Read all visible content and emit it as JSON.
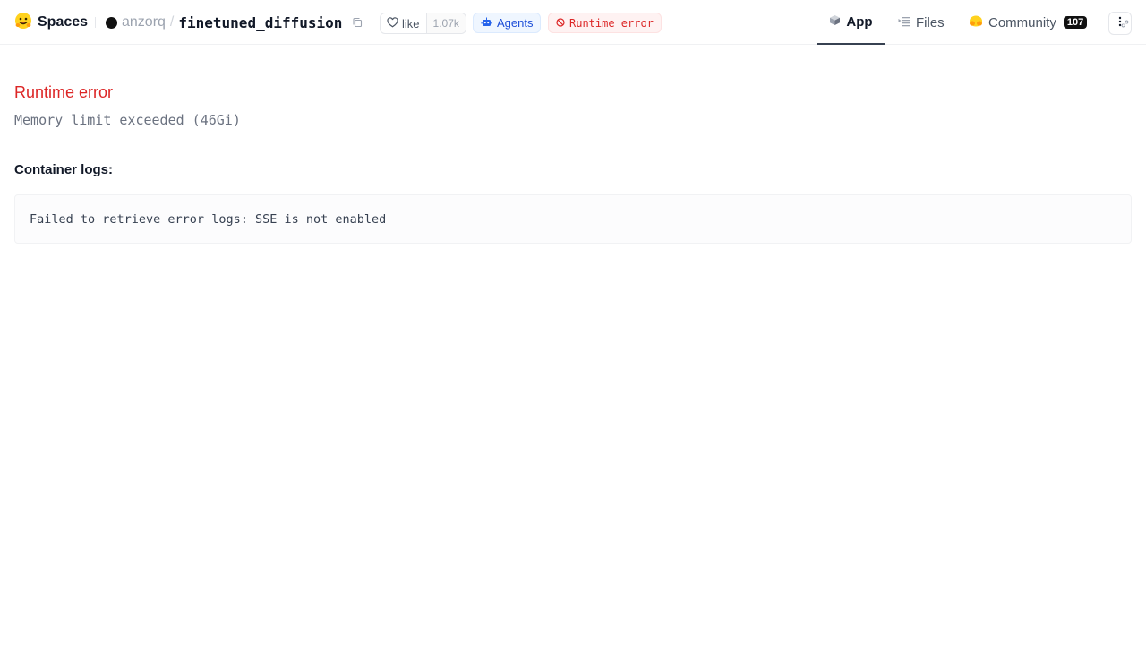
{
  "header": {
    "brand": "Spaces",
    "owner": "anzorq",
    "separator": "/",
    "repo_name": "finetuned_diffusion",
    "like_label": "like",
    "like_count": "1.07k",
    "agents_label": "Agents",
    "status_label": "Runtime error"
  },
  "nav": {
    "tabs": [
      {
        "label": "App",
        "icon": "cube-icon",
        "active": true
      },
      {
        "label": "Files",
        "icon": "files-icon",
        "active": false
      },
      {
        "label": "Community",
        "icon": "hug-icon",
        "active": false,
        "count": "107"
      }
    ]
  },
  "main": {
    "error_title": "Runtime error",
    "error_detail": "Memory limit exceeded (46Gi)",
    "logs_heading": "Container logs:",
    "logs_text": "Failed to retrieve error logs: SSE is not enabled"
  },
  "colors": {
    "error": "#dc2626",
    "agents": "#1d4ed8",
    "active_tab_border": "#374151"
  }
}
